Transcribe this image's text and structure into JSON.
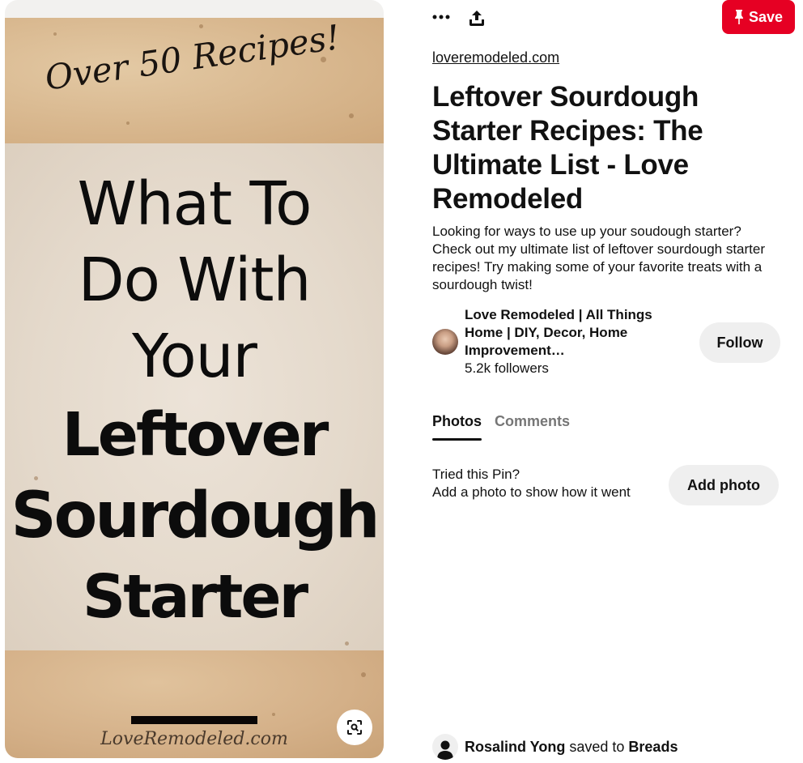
{
  "pin_image": {
    "script_heading": "Over 50 Recipes!",
    "lines": [
      {
        "text": "What To",
        "weight": "light"
      },
      {
        "text": "Do With",
        "weight": "light"
      },
      {
        "text": "Your",
        "weight": "light"
      },
      {
        "text": "Leftover",
        "weight": "bold"
      },
      {
        "text": "Sourdough",
        "weight": "bold"
      },
      {
        "text": "Starter",
        "weight": "bold"
      }
    ],
    "watermark": "LoveRemodeled.com",
    "lens_icon": "visual-search-icon"
  },
  "toolbar": {
    "more_icon": "more-options-icon",
    "share_icon": "share-icon",
    "save_label": "Save",
    "save_icon": "pushpin-icon",
    "save_color": "#e60023"
  },
  "pin": {
    "source": "loveremodeled.com",
    "title": "Leftover Sourdough Starter Recipes: The Ultimate List - Love Remodeled",
    "description": "Looking for ways to use up your soudough starter? Check out my ultimate list of leftover sourdough starter recipes! Try making some of your favorite treats with a sourdough twist!"
  },
  "creator": {
    "name": "Love Remodeled | All Things Home | DIY, Decor, Home Improvement…",
    "followers": "5.2k followers",
    "follow_label": "Follow"
  },
  "tabs": [
    {
      "label": "Photos",
      "active": true
    },
    {
      "label": "Comments",
      "active": false
    }
  ],
  "tried": {
    "line1": "Tried this Pin?",
    "line2": "Add a photo to show how it went",
    "button_label": "Add photo"
  },
  "activity": {
    "user": "Rosalind Yong",
    "action": "saved to",
    "board": "Breads"
  }
}
